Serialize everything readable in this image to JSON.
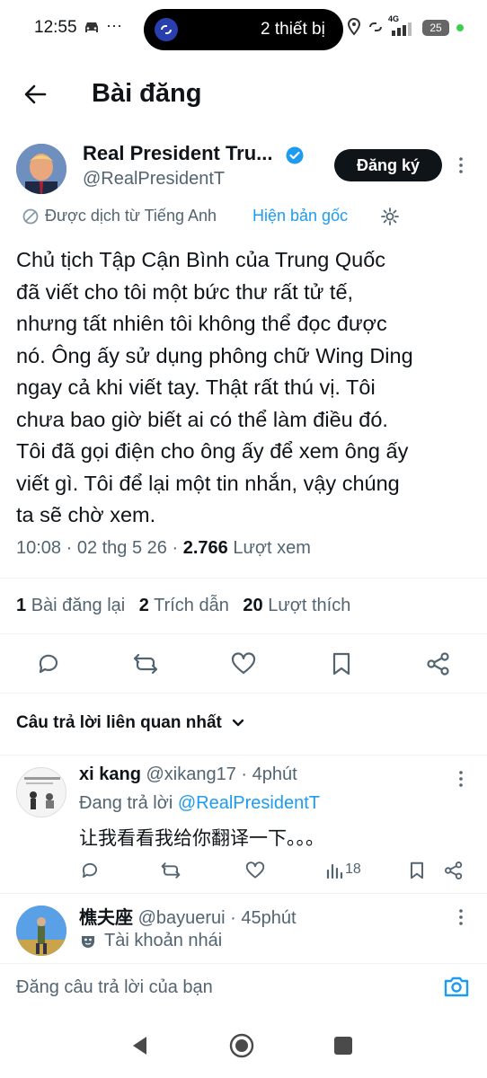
{
  "status_bar": {
    "time": "12:55",
    "dots": "···",
    "devices_label": "2 thiết bị",
    "network": "4G",
    "battery": "25"
  },
  "header": {
    "title": "Bài đăng"
  },
  "post": {
    "author_name": "Real President Tru...",
    "handle": "@RealPresidentT",
    "subscribe_label": "Đăng ký",
    "translated_label": "Được dịch từ Tiếng Anh",
    "show_original_label": "Hiện bản gốc",
    "text_lines": [
      "Chủ tịch Tập Cận Bình của Trung Quốc",
      "đã viết cho tôi một bức thư rất tử tế,",
      "nhưng tất nhiên tôi không thể đọc được",
      "nó. Ông ấy sử dụng phông chữ Wing Ding",
      "ngay cả khi viết tay. Thật rất thú vị. Tôi",
      "chưa bao giờ biết ai có thể làm điều đó.",
      "Tôi đã gọi điện cho ông ấy để xem ông ấy",
      "viết gì. Tôi để lại một tin nhắn, vậy chúng",
      "ta sẽ chờ xem."
    ],
    "meta_time": "10:08 · 02 thg 5 26 ·",
    "views_count": "2.766",
    "views_label": "Lượt xem",
    "stats": {
      "reposts_count": "1",
      "reposts_label": "Bài đăng lại",
      "quotes_count": "2",
      "quotes_label": "Trích dẫn",
      "likes_count": "20",
      "likes_label": "Lượt thích"
    }
  },
  "replies_sort": {
    "label": "Câu trả lời liên quan nhất"
  },
  "replies": [
    {
      "name": "xi kang",
      "handle": "@xikang17",
      "time": "· 4phút",
      "replying_prefix": "Đang trả lời",
      "replying_to": "@RealPresidentT",
      "text": "让我看看我给你翻译一下。。。",
      "views": "18"
    },
    {
      "name": "樵夫座",
      "handle": "@bayuerui",
      "time": "· 45phút",
      "badge_label": "Tài khoản nhái"
    }
  ],
  "compose": {
    "placeholder": "Đăng câu trả lời của bạn"
  },
  "colors": {
    "accent": "#1d9bf0",
    "text": "#0f1419",
    "muted": "#536471"
  }
}
